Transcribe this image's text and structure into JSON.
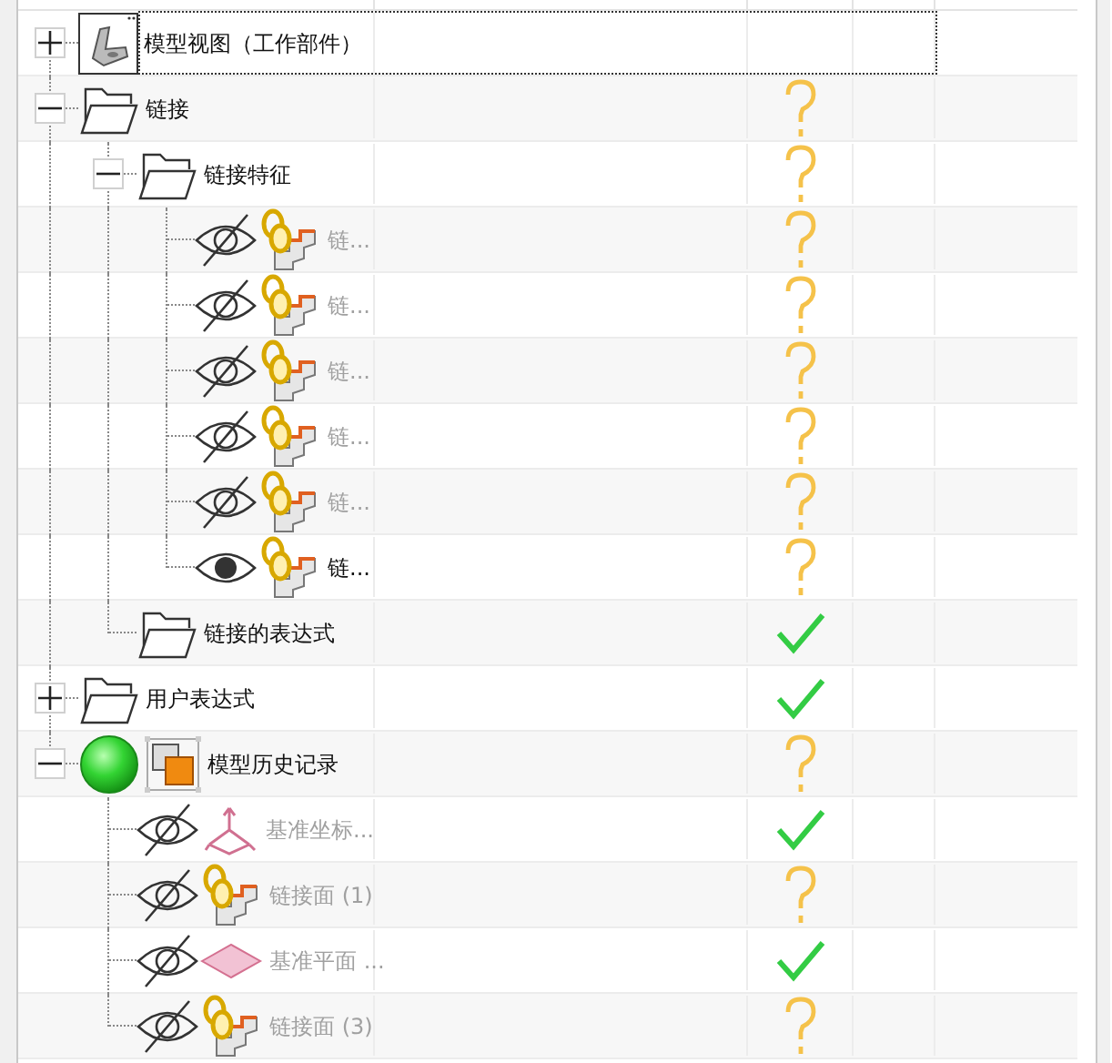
{
  "tree": [
    {
      "label": "模型视图（工作部件）",
      "kind": "part",
      "expanded": false,
      "focused": true
    },
    {
      "label": "链接",
      "kind": "folder",
      "expanded": true,
      "focused": false,
      "status": {
        "kind": "unknown"
      },
      "children": [
        {
          "label": "链接特征",
          "kind": "folder",
          "expanded": true,
          "focused": false,
          "status": {
            "kind": "unknown"
          },
          "children": [
            {
              "label": "链...",
              "kind": "link",
              "visible": false,
              "focused": false,
              "status": {
                "kind": "unknown"
              }
            },
            {
              "label": "链...",
              "kind": "link",
              "visible": false,
              "focused": false,
              "status": {
                "kind": "unknown"
              }
            },
            {
              "label": "链...",
              "kind": "link",
              "visible": false,
              "focused": false,
              "status": {
                "kind": "unknown"
              }
            },
            {
              "label": "链...",
              "kind": "link",
              "visible": false,
              "focused": false,
              "status": {
                "kind": "unknown"
              }
            },
            {
              "label": "链...",
              "kind": "link",
              "visible": false,
              "focused": false,
              "status": {
                "kind": "unknown"
              }
            },
            {
              "label": "链...",
              "kind": "link",
              "visible": true,
              "focused": false,
              "status": {
                "kind": "unknown"
              }
            }
          ]
        },
        {
          "label": "链接的表达式",
          "kind": "folder",
          "focused": false,
          "status": {
            "kind": "ok"
          }
        }
      ]
    },
    {
      "label": "用户表达式",
      "kind": "folder",
      "expanded": false,
      "focused": false,
      "status": {
        "kind": "ok"
      }
    },
    {
      "label": "模型历史记录",
      "kind": "history",
      "expanded": true,
      "active": true,
      "focused": false,
      "status": {
        "kind": "unknown"
      },
      "children": [
        {
          "label": "基准坐标...",
          "kind": "csys",
          "visible": false,
          "focused": false,
          "status": {
            "kind": "ok"
          }
        },
        {
          "label": "链接面 (1)",
          "kind": "link",
          "visible": false,
          "focused": false,
          "status": {
            "kind": "unknown"
          }
        },
        {
          "label": "基准平面 ...",
          "kind": "plane",
          "visible": false,
          "focused": false,
          "status": {
            "kind": "ok"
          }
        },
        {
          "label": "链接面 (3)",
          "kind": "link",
          "visible": false,
          "focused": false,
          "status": {
            "kind": "unknown"
          }
        }
      ]
    }
  ]
}
